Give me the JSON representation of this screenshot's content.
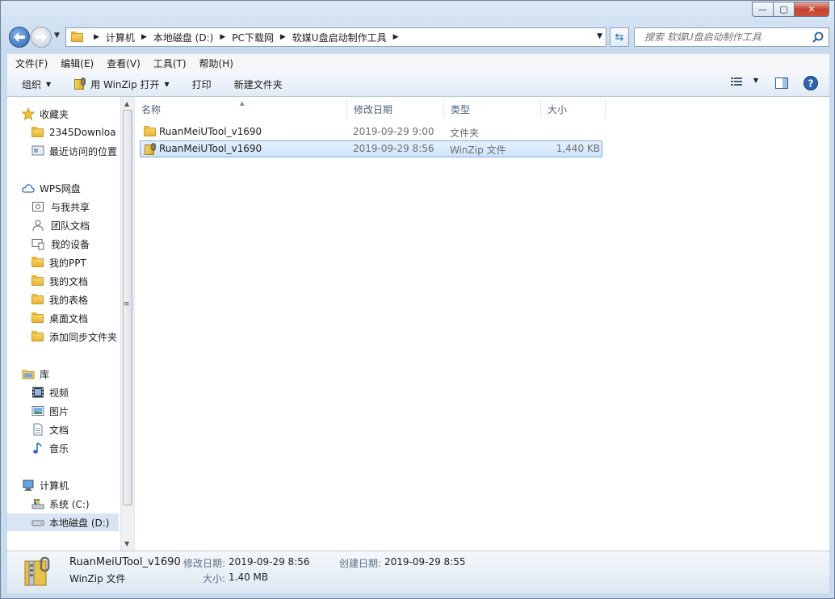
{
  "window": {
    "minimize_glyph": "—",
    "maximize_glyph": "▢",
    "close_glyph": "✕"
  },
  "address": {
    "crumbs": [
      "计算机",
      "本地磁盘 (D:)",
      "PC下载网",
      "软媒U盘启动制作工具"
    ]
  },
  "search": {
    "placeholder": "搜索 软媒U盘启动制作工具"
  },
  "menu": [
    "文件(F)",
    "编辑(E)",
    "查看(V)",
    "工具(T)",
    "帮助(H)"
  ],
  "toolbar": {
    "organize": "组织",
    "open_with": "用 WinZip 打开",
    "print": "打印",
    "new_folder": "新建文件夹"
  },
  "sidebar": {
    "favorites": "收藏夹",
    "fav_items": [
      "2345Downloa",
      "最近访问的位置"
    ],
    "wps": "WPS网盘",
    "wps_items": [
      "与我共享",
      "团队文档",
      "我的设备",
      "我的PPT",
      "我的文档",
      "我的表格",
      "桌面文档",
      "添加同步文件夹"
    ],
    "library": "库",
    "lib_items": [
      "视频",
      "图片",
      "文档",
      "音乐"
    ],
    "computer": "计算机",
    "comp_items": [
      "系统 (C:)",
      "本地磁盘 (D:)"
    ]
  },
  "columns": {
    "name": "名称",
    "modified": "修改日期",
    "type": "类型",
    "size": "大小"
  },
  "files": [
    {
      "name": "RuanMeiUTool_v1690",
      "modified": "2019-09-29 9:00",
      "type": "文件夹",
      "size": "",
      "icon": "folder-icon"
    },
    {
      "name": "RuanMeiUTool_v1690",
      "modified": "2019-09-29 8:56",
      "type": "WinZip 文件",
      "size": "1,440 KB",
      "icon": "winzip-icon"
    }
  ],
  "details": {
    "name": "RuanMeiUTool_v1690",
    "type": "WinZip 文件",
    "modified_label": "修改日期:",
    "modified": "2019-09-29 8:56",
    "created_label": "创建日期:",
    "created": "2019-09-29 8:55",
    "size_label": "大小:",
    "size": "1.40 MB"
  },
  "colors": {
    "accent": "#2e63b0",
    "selection": "#cde4fb",
    "chrome": "#c9dbee"
  }
}
